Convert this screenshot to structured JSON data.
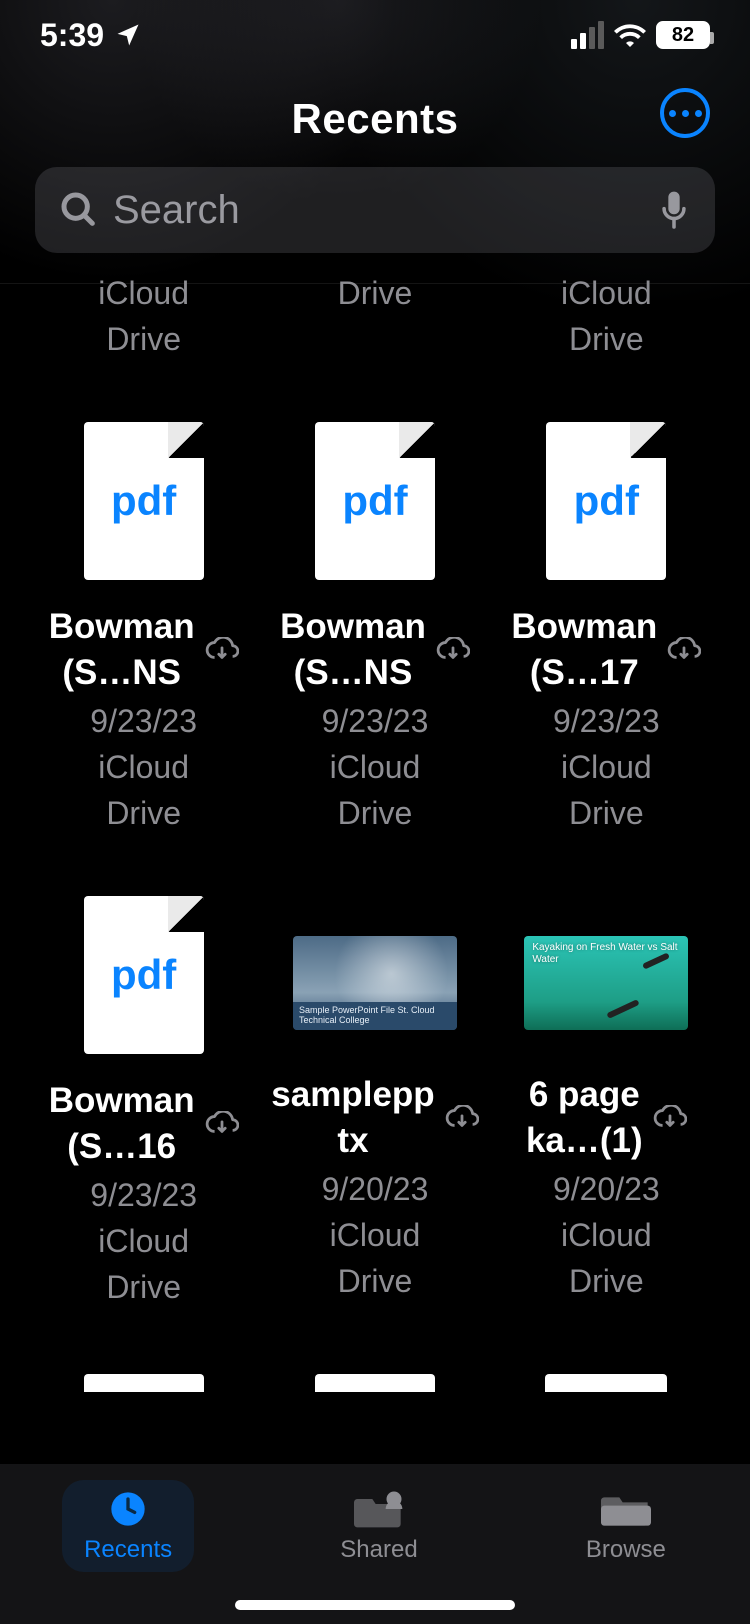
{
  "status": {
    "time": "5:39",
    "battery_pct": "82"
  },
  "header": {
    "title": "Recents"
  },
  "search": {
    "placeholder": "Search"
  },
  "row_prev": [
    {
      "loc": "iCloud\nDrive"
    },
    {
      "loc": "Drive"
    },
    {
      "loc": "iCloud\nDrive"
    }
  ],
  "files": [
    {
      "kind": "pdf",
      "ext": "pdf",
      "name": "Bowman\n(S…NS",
      "has_cloud": true,
      "date": "9/23/23",
      "loc": "iCloud\nDrive"
    },
    {
      "kind": "pdf",
      "ext": "pdf",
      "name": "Bowman\n(S…NS",
      "has_cloud": true,
      "date": "9/23/23",
      "loc": "iCloud\nDrive"
    },
    {
      "kind": "pdf",
      "ext": "pdf",
      "name": "Bowman\n(S…17",
      "has_cloud": true,
      "date": "9/23/23",
      "loc": "iCloud\nDrive"
    },
    {
      "kind": "pdf",
      "ext": "pdf",
      "name": "Bowman\n(S…16",
      "has_cloud": true,
      "date": "9/23/23",
      "loc": "iCloud\nDrive"
    },
    {
      "kind": "ppt",
      "ppt_label": "Sample PowerPoint File\nSt. Cloud Technical College",
      "name": "samplepp\ntx",
      "has_cloud": true,
      "date": "9/20/23",
      "loc": "iCloud\nDrive"
    },
    {
      "kind": "kayak",
      "thumb_text": "Kayaking on\nFresh Water\nvs\nSalt Water",
      "name": "6 page\nka…(1)",
      "has_cloud": true,
      "date": "9/20/23",
      "loc": "iCloud\nDrive"
    }
  ],
  "tabs": [
    {
      "id": "recents",
      "label": "Recents",
      "active": true
    },
    {
      "id": "shared",
      "label": "Shared",
      "active": false
    },
    {
      "id": "browse",
      "label": "Browse",
      "active": false
    }
  ]
}
